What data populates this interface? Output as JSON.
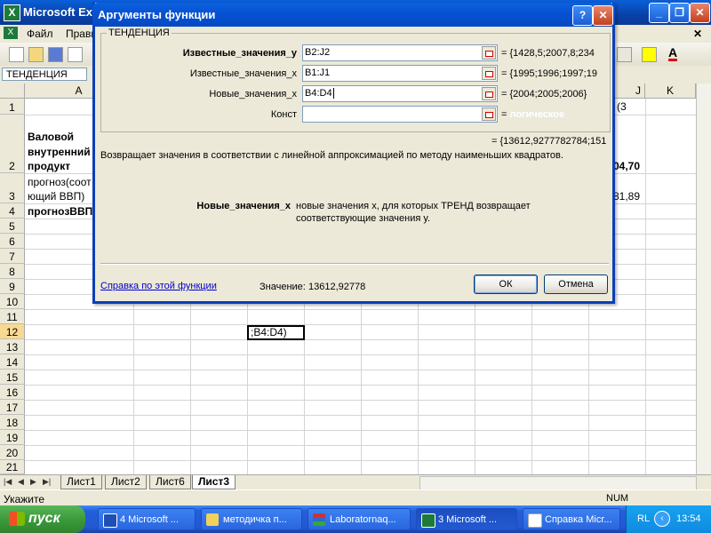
{
  "excel": {
    "title": "Microsoft Exc",
    "menus": [
      "Файл",
      "Правк"
    ],
    "name_box": "ТЕНДЕНЦИЯ",
    "columns": [
      "A",
      "J",
      "K"
    ],
    "rows": [
      "1",
      "2",
      "3",
      "4",
      "5",
      "6",
      "7",
      "8",
      "9",
      "10",
      "11",
      "12",
      "13",
      "14",
      "15",
      "16",
      "17",
      "18",
      "19",
      "20",
      "21"
    ],
    "cells": {
      "a2_line1": "Валовой",
      "a2_line2": "внутренний",
      "a2_line3": "продукт",
      "a3_line1": "прогноз(соот",
      "a3_line2": "ющий ВВП)",
      "a4": "прогнозВВП",
      "j1": "(3",
      "j2": "04,70",
      "j3": "81,89",
      "edit_cell": ";B4:D4)"
    },
    "sheets": [
      "Лист1",
      "Лист2",
      "Лист6",
      "Лист3"
    ],
    "active_sheet": "Лист3",
    "status": "Укажите",
    "num_indicator": "NUM"
  },
  "dialog": {
    "title": "Аргументы функции",
    "help_glyph": "?",
    "close_glyph": "✕",
    "function_name": "ТЕНДЕНЦИЯ",
    "args": [
      {
        "label": "Известные_значения_y",
        "value": "B2:J2",
        "result": "= {1428,5;2007,8;234",
        "bold": true
      },
      {
        "label": "Известные_значения_x",
        "value": "B1:J1",
        "result": "= {1995;1996;1997;19",
        "bold": false
      },
      {
        "label": "Новые_значения_x",
        "value": "B4:D4",
        "result": "= {2004;2005;2006}",
        "bold": false
      },
      {
        "label": "Конст",
        "value": "",
        "result_eq": "=",
        "result": "логическое",
        "bold": false
      }
    ],
    "formula_result": "= {13612,9277782784;151",
    "description": "Возвращает значения в соответствии с линейной аппроксимацией по методу наименьших квадратов.",
    "arg_help_name": "Новые_значения_x",
    "arg_help_text_1": "новые значения x, для которых ТРЕНД возвращает",
    "arg_help_text_2": "соответствующие значения y.",
    "help_link": "Справка по этой функции",
    "value_label": "Значение:",
    "value": "13612,92778",
    "ok": "ОК",
    "cancel": "Отмена"
  },
  "taskbar": {
    "start": "пуск",
    "tasks": [
      {
        "label": "4 Microsoft ...",
        "active": false
      },
      {
        "label": "методичка п...",
        "active": false
      },
      {
        "label": "Laboratornaq...",
        "active": false
      },
      {
        "label": "3 Microsoft ...",
        "active": true
      },
      {
        "label": "Справка Micr...",
        "active": false
      }
    ],
    "lang": "RL",
    "clock": "13:54"
  },
  "colors": {
    "xp_blue": "#0a5fd8",
    "start_green": "#3c9a3c",
    "dialog_bg": "#ece9d8"
  }
}
